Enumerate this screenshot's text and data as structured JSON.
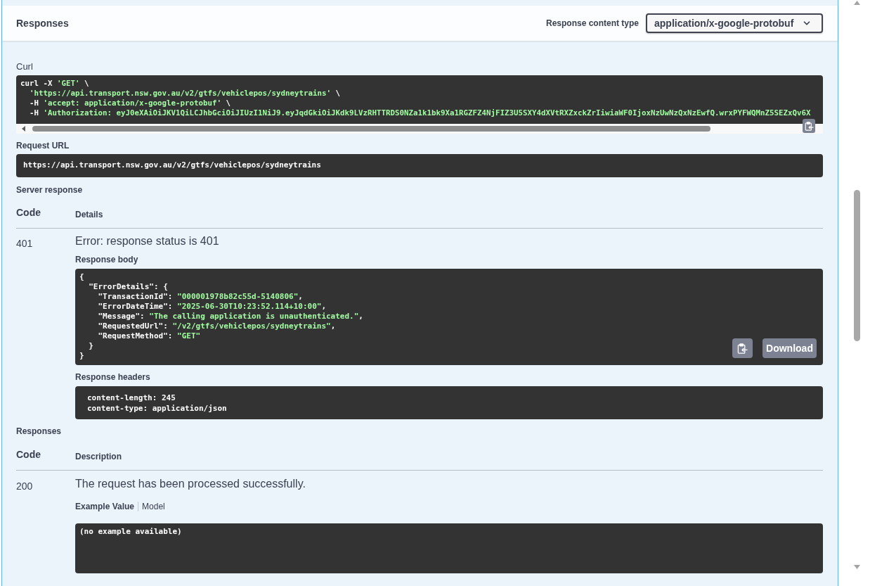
{
  "header": {
    "title": "Responses",
    "content_type": {
      "label": "Response content type",
      "value": "application/x-google-protobuf"
    }
  },
  "curl": {
    "label": "Curl",
    "lines": [
      [
        {
          "text": "curl -X ",
          "kind": "plain"
        },
        {
          "text": "'GET'",
          "kind": "string"
        },
        {
          "text": " \\",
          "kind": "plain"
        }
      ],
      [
        {
          "text": "  'https://api.transport.nsw.gov.au/v2/gtfs/vehiclepos/sydneytrains'",
          "kind": "string"
        },
        {
          "text": " \\",
          "kind": "plain"
        }
      ],
      [
        {
          "text": "  -H ",
          "kind": "plain"
        },
        {
          "text": "'accept: application/x-google-protobuf'",
          "kind": "string"
        },
        {
          "text": " \\",
          "kind": "plain"
        }
      ],
      [
        {
          "text": "  -H ",
          "kind": "plain"
        },
        {
          "text": "'Authorization: eyJ0eXAiOiJKV1QiLCJhbGciOiJIUzI1NiJ9.eyJqdGkiOiJKdk9LVzRHTTRDS0NZa1k1bk9Xa1RGZFZ4NjFIZ3U5SXY4dXVtRXZxckZrIiwiaWF0IjoxNzUwNzQxNzEwfQ.wrxPYFWQMnZ5SEZxQv6X",
          "kind": "string"
        }
      ]
    ]
  },
  "request_url": {
    "label": "Request URL",
    "value": "https://api.transport.nsw.gov.au/v2/gtfs/vehiclepos/sydneytrains"
  },
  "server_response": {
    "label": "Server response",
    "columns": [
      "Code",
      "Details"
    ],
    "rows": [
      {
        "code": "401",
        "message": "Error: response status is 401",
        "body": {
          "label": "Response body",
          "lines": [
            [
              {
                "text": "{",
                "kind": "plain"
              }
            ],
            [
              {
                "text": "  \"ErrorDetails\": {",
                "kind": "plain"
              }
            ],
            [
              {
                "text": "    \"TransactionId\": ",
                "kind": "plain"
              },
              {
                "text": "\"000001978b82c55d-5140806\"",
                "kind": "string"
              },
              {
                "text": ",",
                "kind": "plain"
              }
            ],
            [
              {
                "text": "    \"ErrorDateTime\": ",
                "kind": "plain"
              },
              {
                "text": "\"2025-06-30T10:23:52.114+10:00\"",
                "kind": "string"
              },
              {
                "text": ",",
                "kind": "plain"
              }
            ],
            [
              {
                "text": "    \"Message\": ",
                "kind": "plain"
              },
              {
                "text": "\"The calling application is unauthenticated.\"",
                "kind": "string"
              },
              {
                "text": ",",
                "kind": "plain"
              }
            ],
            [
              {
                "text": "    \"RequestedUrl\": ",
                "kind": "plain"
              },
              {
                "text": "\"/v2/gtfs/vehiclepos/sydneytrains\"",
                "kind": "string"
              },
              {
                "text": ",",
                "kind": "plain"
              }
            ],
            [
              {
                "text": "    \"RequestMethod\": ",
                "kind": "plain"
              },
              {
                "text": "\"GET\"",
                "kind": "string"
              }
            ],
            [
              {
                "text": "  }",
                "kind": "plain"
              }
            ],
            [
              {
                "text": "}",
                "kind": "plain"
              }
            ]
          ],
          "download": "Download"
        },
        "headers": {
          "label": "Response headers",
          "lines": [
            "content-length: 245",
            "content-type: application/json"
          ]
        }
      }
    ]
  },
  "responses": {
    "label": "Responses",
    "columns": [
      "Code",
      "Description"
    ],
    "rows": [
      {
        "code": "200",
        "description": "The request has been processed successfully.",
        "tabs": [
          {
            "label": "Example Value",
            "selected": true
          },
          {
            "label": "Model",
            "selected": false
          }
        ],
        "example": "(no example available)"
      }
    ]
  }
}
